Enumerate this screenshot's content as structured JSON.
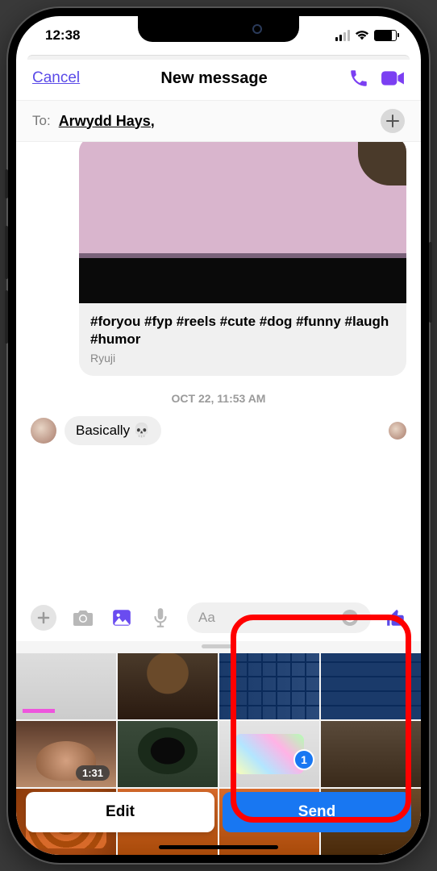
{
  "status": {
    "time": "12:38"
  },
  "header": {
    "cancel": "Cancel",
    "title": "New message"
  },
  "compose": {
    "to_label": "To:",
    "recipient": "Arwydd Hays,"
  },
  "shared_card": {
    "tags": "#foryou #fyp #reels #cute #dog #funny #laugh #humor",
    "author": "Ryuji"
  },
  "timestamp": "OCT 22, 11:53 AM",
  "message": {
    "text": "Basically",
    "emoji": "💀"
  },
  "input": {
    "placeholder": "Aa"
  },
  "gallery": {
    "video_duration": "1:31",
    "selection_count": "1"
  },
  "buttons": {
    "edit": "Edit",
    "send": "Send"
  }
}
